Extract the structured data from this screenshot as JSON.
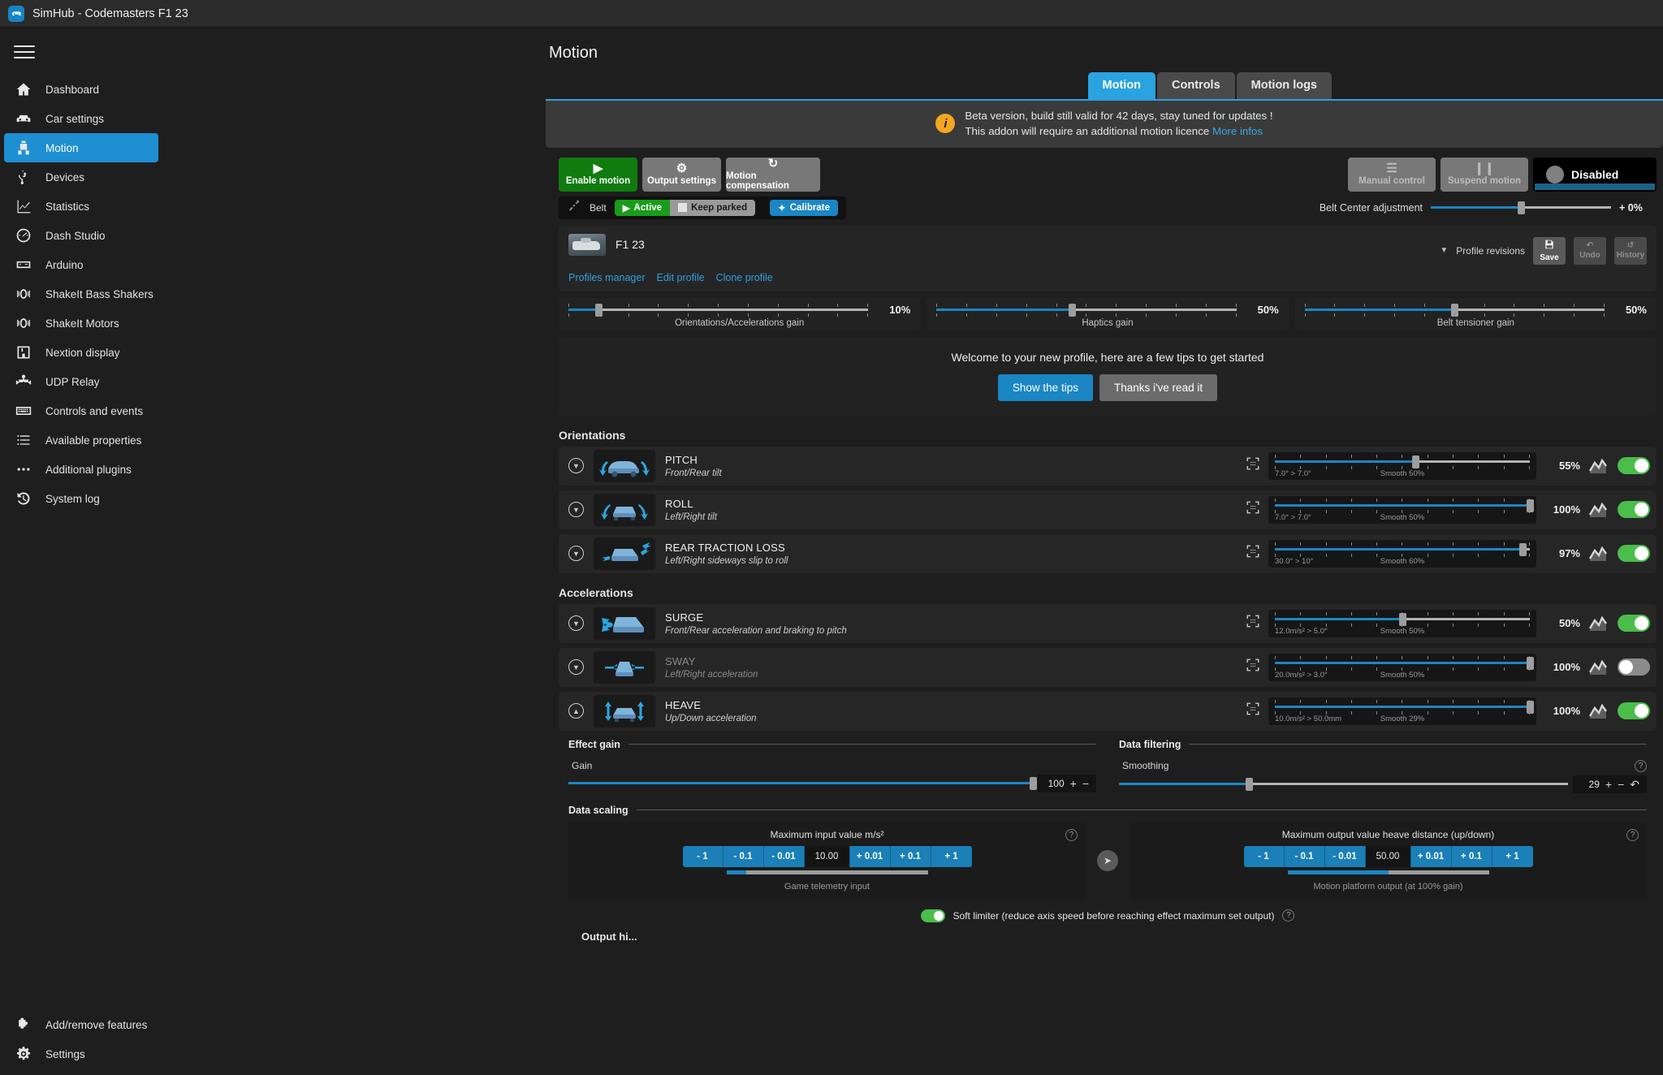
{
  "window": {
    "title": "SimHub - Codemasters F1 23",
    "logo_icon": "gamepad-icon"
  },
  "sidebar": {
    "menu_icon": "hamburger-icon",
    "items": [
      {
        "label": "Dashboard",
        "icon": "home-icon",
        "active": false
      },
      {
        "label": "Car settings",
        "icon": "car-icon",
        "active": false
      },
      {
        "label": "Motion",
        "icon": "motion-rig-icon",
        "active": true
      },
      {
        "label": "Devices",
        "icon": "usb-icon",
        "active": false
      },
      {
        "label": "Statistics",
        "icon": "chart-icon",
        "active": false
      },
      {
        "label": "Dash Studio",
        "icon": "gauge-icon",
        "active": false
      },
      {
        "label": "Arduino",
        "icon": "arduino-icon",
        "active": false
      },
      {
        "label": "ShakeIt Bass Shakers",
        "icon": "speaker-wave-icon",
        "active": false
      },
      {
        "label": "ShakeIt Motors",
        "icon": "speaker-wave-icon",
        "active": false
      },
      {
        "label": "Nextion display",
        "icon": "display-icon",
        "active": false
      },
      {
        "label": "UDP Relay",
        "icon": "network-icon",
        "active": false
      },
      {
        "label": "Controls and events",
        "icon": "keyboard-icon",
        "active": false
      },
      {
        "label": "Available properties",
        "icon": "list-icon",
        "active": false
      },
      {
        "label": "Additional plugins",
        "icon": "dots-icon",
        "active": false
      },
      {
        "label": "System log",
        "icon": "history-icon",
        "active": false
      }
    ],
    "bottom_items": [
      {
        "label": "Add/remove features",
        "icon": "puzzle-icon"
      },
      {
        "label": "Settings",
        "icon": "gear-icon"
      }
    ]
  },
  "page": {
    "title": "Motion",
    "tabs": [
      {
        "label": "Motion",
        "active": true
      },
      {
        "label": "Controls",
        "active": false
      },
      {
        "label": "Motion logs",
        "active": false
      }
    ]
  },
  "beta_banner": {
    "icon": "info-icon",
    "line1": "Beta version, build still valid for 42 days, stay tuned for updates !",
    "line2": "This addon will require an additional motion licence",
    "link": "More infos"
  },
  "actions": {
    "enable_motion": {
      "label": "Enable motion",
      "icon": "play-icon"
    },
    "output_settings": {
      "label": "Output settings",
      "icon": "gears-icon"
    },
    "motion_compensation": {
      "label": "Motion compensation",
      "icon": "refresh-icon"
    },
    "manual_control": {
      "label": "Manual control",
      "icon": "sliders-icon",
      "disabled": true
    },
    "suspend_motion": {
      "label": "Suspend motion",
      "icon": "pause-icon",
      "disabled": true
    },
    "state": {
      "label": "Disabled"
    }
  },
  "belt": {
    "icon": "seatbelt-icon",
    "label": "Belt",
    "active_label": "Active",
    "keep_parked_label": "Keep parked",
    "calibrate_label": "Calibrate",
    "calibrate_icon": "wand-icon",
    "center_adjust_label": "Belt Center adjustment",
    "center_adjust_value": "+ 0%",
    "center_adjust_pct": 50
  },
  "profile": {
    "name": "F1 23",
    "thumb_icon": "f1-car-thumbnail",
    "links": [
      "Profiles manager",
      "Edit profile",
      "Clone profile"
    ],
    "dropdown_icon": "chevron-down-icon",
    "revisions_label": "Profile revisions",
    "buttons": [
      {
        "label": "Save",
        "icon": "save-icon",
        "disabled": false
      },
      {
        "label": "Undo",
        "icon": "undo-icon",
        "disabled": true
      },
      {
        "label": "History",
        "icon": "history-icon",
        "disabled": true
      }
    ],
    "gains": [
      {
        "label": "Orientations/Accelerations gain",
        "value": "10%",
        "pct": 10
      },
      {
        "label": "Haptics gain",
        "value": "50%",
        "pct": 45
      },
      {
        "label": "Belt tensioner gain",
        "value": "50%",
        "pct": 50
      }
    ]
  },
  "tips": {
    "text": "Welcome to your new profile, here are a few tips to get started",
    "show_label": "Show the tips",
    "thanks_label": "Thanks i've read it"
  },
  "sections": [
    {
      "title": "Orientations",
      "effects": [
        {
          "name": "PITCH",
          "desc": "Front/Rear tilt",
          "icon": "pitch-car-icon",
          "value": "55%",
          "pct": 55,
          "range": "7.0° > 7.0°",
          "smooth": "Smooth 50%",
          "enabled": true,
          "expanded": false,
          "graph_icon": "graph-icon",
          "expand_icon": "chevron-down-icon"
        },
        {
          "name": "ROLL",
          "desc": "Left/Right tilt",
          "icon": "roll-car-icon",
          "value": "100%",
          "pct": 100,
          "range": "7.0° > 7.0°",
          "smooth": "Smooth 50%",
          "enabled": true,
          "expanded": false,
          "graph_icon": "graph-icon",
          "expand_icon": "chevron-down-icon"
        },
        {
          "name": "REAR TRACTION LOSS",
          "desc": "Left/Right sideways slip to roll",
          "icon": "traction-loss-car-icon",
          "value": "97%",
          "pct": 97,
          "range": "30.0° > 10°",
          "smooth": "Smooth 60%",
          "enabled": true,
          "expanded": false,
          "graph_icon": "graph-icon",
          "expand_icon": "chevron-down-icon"
        }
      ]
    },
    {
      "title": "Accelerations",
      "effects": [
        {
          "name": "SURGE",
          "desc": "Front/Rear acceleration and braking to pitch",
          "icon": "surge-car-icon",
          "value": "50%",
          "pct": 50,
          "range": "12.0m/s² > 5.0°",
          "smooth": "Smooth 50%",
          "enabled": true,
          "expanded": false,
          "graph_icon": "graph-icon",
          "expand_icon": "chevron-down-icon"
        },
        {
          "name": "SWAY",
          "desc": "Left/Right acceleration",
          "icon": "sway-car-icon",
          "value": "100%",
          "pct": 100,
          "range": "20.0m/s² > 3.0°",
          "smooth": "Smooth 50%",
          "enabled": false,
          "expanded": false,
          "graph_icon": "graph-icon",
          "expand_icon": "chevron-down-icon"
        },
        {
          "name": "HEAVE",
          "desc": "Up/Down acceleration",
          "icon": "heave-car-icon",
          "value": "100%",
          "pct": 100,
          "range": "10.0m/s² > 50.0mm",
          "smooth": "Smooth 29%",
          "enabled": true,
          "expanded": true,
          "graph_icon": "graph-icon",
          "expand_icon": "chevron-up-icon"
        }
      ]
    }
  ],
  "heave_panel": {
    "effect_gain": {
      "group_title": "Effect gain",
      "field_label": "Gain",
      "value": "100",
      "pct": 100,
      "plus": "+",
      "minus": "−"
    },
    "data_filtering": {
      "group_title": "Data filtering",
      "field_label": "Smoothing",
      "value": "29",
      "pct": 29,
      "plus": "+",
      "minus": "−",
      "reset_icon": "undo-icon",
      "help_icon": "question-icon"
    },
    "data_scaling": {
      "group_title": "Data scaling",
      "input": {
        "title": "Maximum input value m/s²",
        "value": "10.00",
        "steps_left": [
          "- 1",
          "- 0.1",
          "- 0.01"
        ],
        "steps_right": [
          "+ 0.01",
          "+ 0.1",
          "+ 1"
        ],
        "footer": "Game telemetry input",
        "bar_pct": 10,
        "help_icon": "question-icon"
      },
      "link_icon": "arrow-right-icon",
      "output": {
        "title": "Maximum output value heave distance (up/down)",
        "value": "50.00",
        "steps_left": [
          "- 1",
          "- 0.1",
          "- 0.01"
        ],
        "steps_right": [
          "+ 0.01",
          "+ 0.1",
          "+ 1"
        ],
        "footer": "Motion platform output (at 100% gain)",
        "bar_pct": 50,
        "help_icon": "question-icon"
      }
    },
    "soft_limiter": {
      "label": "Soft limiter (reduce axis speed before reaching effect maximum set output)",
      "enabled": true,
      "help_icon": "question-icon"
    },
    "next_group": "Output hi..."
  }
}
